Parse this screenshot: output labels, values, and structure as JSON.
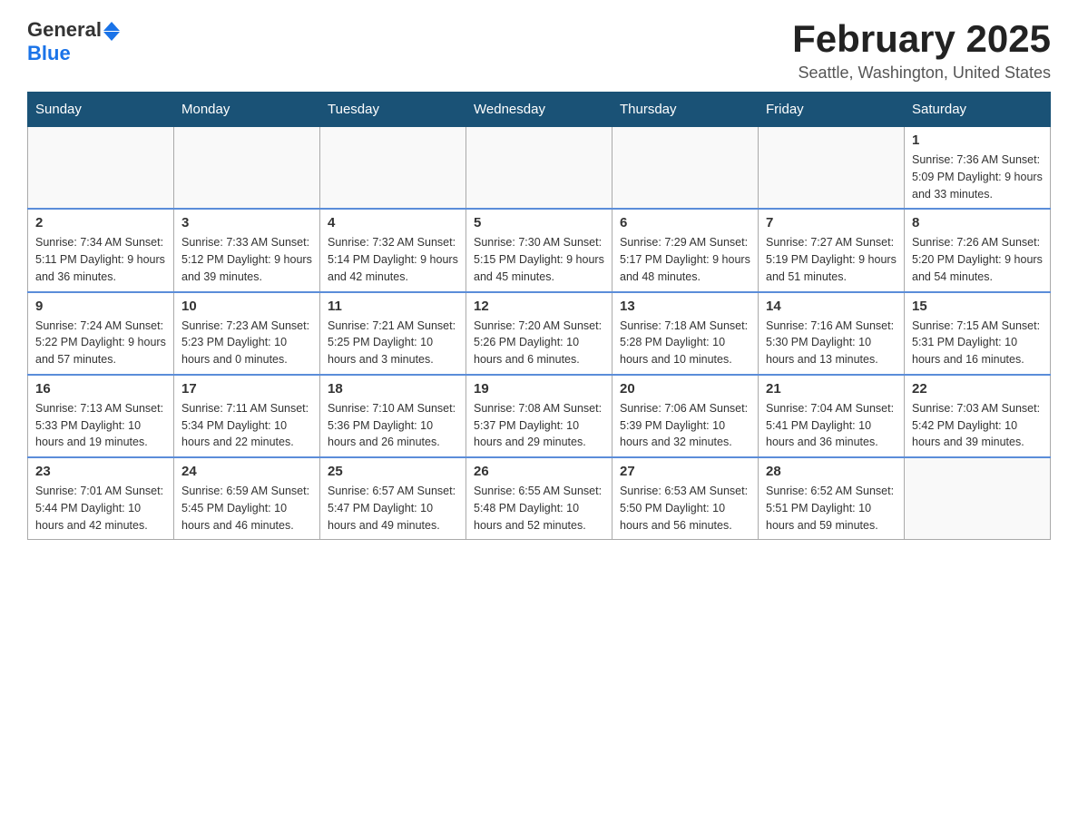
{
  "logo": {
    "text_general": "General",
    "text_blue": "Blue"
  },
  "header": {
    "title": "February 2025",
    "subtitle": "Seattle, Washington, United States"
  },
  "weekdays": [
    "Sunday",
    "Monday",
    "Tuesday",
    "Wednesday",
    "Thursday",
    "Friday",
    "Saturday"
  ],
  "weeks": [
    [
      {
        "day": "",
        "info": ""
      },
      {
        "day": "",
        "info": ""
      },
      {
        "day": "",
        "info": ""
      },
      {
        "day": "",
        "info": ""
      },
      {
        "day": "",
        "info": ""
      },
      {
        "day": "",
        "info": ""
      },
      {
        "day": "1",
        "info": "Sunrise: 7:36 AM\nSunset: 5:09 PM\nDaylight: 9 hours and 33 minutes."
      }
    ],
    [
      {
        "day": "2",
        "info": "Sunrise: 7:34 AM\nSunset: 5:11 PM\nDaylight: 9 hours and 36 minutes."
      },
      {
        "day": "3",
        "info": "Sunrise: 7:33 AM\nSunset: 5:12 PM\nDaylight: 9 hours and 39 minutes."
      },
      {
        "day": "4",
        "info": "Sunrise: 7:32 AM\nSunset: 5:14 PM\nDaylight: 9 hours and 42 minutes."
      },
      {
        "day": "5",
        "info": "Sunrise: 7:30 AM\nSunset: 5:15 PM\nDaylight: 9 hours and 45 minutes."
      },
      {
        "day": "6",
        "info": "Sunrise: 7:29 AM\nSunset: 5:17 PM\nDaylight: 9 hours and 48 minutes."
      },
      {
        "day": "7",
        "info": "Sunrise: 7:27 AM\nSunset: 5:19 PM\nDaylight: 9 hours and 51 minutes."
      },
      {
        "day": "8",
        "info": "Sunrise: 7:26 AM\nSunset: 5:20 PM\nDaylight: 9 hours and 54 minutes."
      }
    ],
    [
      {
        "day": "9",
        "info": "Sunrise: 7:24 AM\nSunset: 5:22 PM\nDaylight: 9 hours and 57 minutes."
      },
      {
        "day": "10",
        "info": "Sunrise: 7:23 AM\nSunset: 5:23 PM\nDaylight: 10 hours and 0 minutes."
      },
      {
        "day": "11",
        "info": "Sunrise: 7:21 AM\nSunset: 5:25 PM\nDaylight: 10 hours and 3 minutes."
      },
      {
        "day": "12",
        "info": "Sunrise: 7:20 AM\nSunset: 5:26 PM\nDaylight: 10 hours and 6 minutes."
      },
      {
        "day": "13",
        "info": "Sunrise: 7:18 AM\nSunset: 5:28 PM\nDaylight: 10 hours and 10 minutes."
      },
      {
        "day": "14",
        "info": "Sunrise: 7:16 AM\nSunset: 5:30 PM\nDaylight: 10 hours and 13 minutes."
      },
      {
        "day": "15",
        "info": "Sunrise: 7:15 AM\nSunset: 5:31 PM\nDaylight: 10 hours and 16 minutes."
      }
    ],
    [
      {
        "day": "16",
        "info": "Sunrise: 7:13 AM\nSunset: 5:33 PM\nDaylight: 10 hours and 19 minutes."
      },
      {
        "day": "17",
        "info": "Sunrise: 7:11 AM\nSunset: 5:34 PM\nDaylight: 10 hours and 22 minutes."
      },
      {
        "day": "18",
        "info": "Sunrise: 7:10 AM\nSunset: 5:36 PM\nDaylight: 10 hours and 26 minutes."
      },
      {
        "day": "19",
        "info": "Sunrise: 7:08 AM\nSunset: 5:37 PM\nDaylight: 10 hours and 29 minutes."
      },
      {
        "day": "20",
        "info": "Sunrise: 7:06 AM\nSunset: 5:39 PM\nDaylight: 10 hours and 32 minutes."
      },
      {
        "day": "21",
        "info": "Sunrise: 7:04 AM\nSunset: 5:41 PM\nDaylight: 10 hours and 36 minutes."
      },
      {
        "day": "22",
        "info": "Sunrise: 7:03 AM\nSunset: 5:42 PM\nDaylight: 10 hours and 39 minutes."
      }
    ],
    [
      {
        "day": "23",
        "info": "Sunrise: 7:01 AM\nSunset: 5:44 PM\nDaylight: 10 hours and 42 minutes."
      },
      {
        "day": "24",
        "info": "Sunrise: 6:59 AM\nSunset: 5:45 PM\nDaylight: 10 hours and 46 minutes."
      },
      {
        "day": "25",
        "info": "Sunrise: 6:57 AM\nSunset: 5:47 PM\nDaylight: 10 hours and 49 minutes."
      },
      {
        "day": "26",
        "info": "Sunrise: 6:55 AM\nSunset: 5:48 PM\nDaylight: 10 hours and 52 minutes."
      },
      {
        "day": "27",
        "info": "Sunrise: 6:53 AM\nSunset: 5:50 PM\nDaylight: 10 hours and 56 minutes."
      },
      {
        "day": "28",
        "info": "Sunrise: 6:52 AM\nSunset: 5:51 PM\nDaylight: 10 hours and 59 minutes."
      },
      {
        "day": "",
        "info": ""
      }
    ]
  ]
}
